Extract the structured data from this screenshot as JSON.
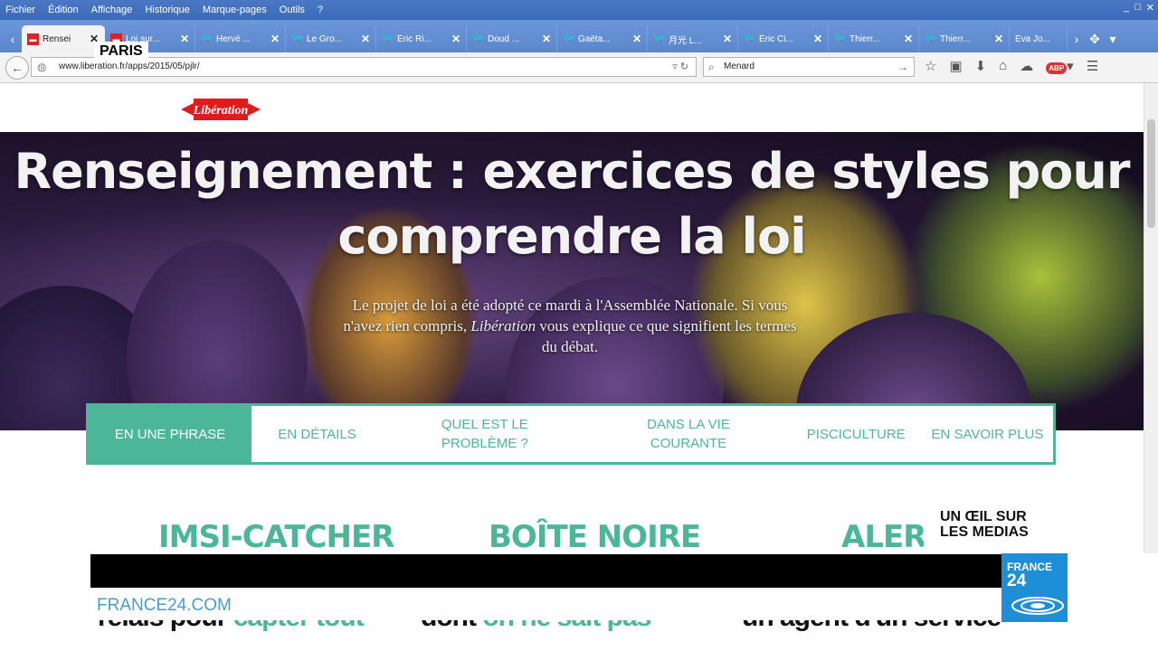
{
  "menubar": {
    "items": [
      "Fichier",
      "Édition",
      "Affichage",
      "Historique",
      "Marque-pages",
      "Outils",
      "?"
    ],
    "window_controls": [
      "_",
      "□",
      "✕"
    ]
  },
  "tabs": [
    {
      "title": "Rensei",
      "active": true,
      "icon": "liberation-favicon"
    },
    {
      "title": "Loi sur...",
      "icon": "liberation-favicon"
    },
    {
      "title": "Hervé ...",
      "icon": "twitter-icon"
    },
    {
      "title": "Le Gro...",
      "icon": "twitter-icon"
    },
    {
      "title": "Éric Ri...",
      "icon": "twitter-icon"
    },
    {
      "title": "Doud ...",
      "icon": "twitter-icon"
    },
    {
      "title": "Gaëta...",
      "icon": "twitter-icon"
    },
    {
      "title": "月光 L...",
      "icon": "twitter-icon"
    },
    {
      "title": "Eric Ci...",
      "icon": "twitter-icon"
    },
    {
      "title": "Thierr...",
      "icon": "twitter-icon"
    },
    {
      "title": "Thierr...",
      "icon": "twitter-icon"
    },
    {
      "title": "Eva Jo...",
      "icon": "twitter-icon"
    }
  ],
  "location_badge": "PARIS",
  "navbar": {
    "url": "www.liberation.fr/apps/2015/05/pjlr/",
    "search_value": "Menard"
  },
  "logo_text": "Libération",
  "hero": {
    "title_line1": "Renseignement : exercices de styles pour",
    "title_line2": "comprendre la loi",
    "intro_1": "Le projet de loi a été adopté ce mardi à l'Assemblée Nationale. Si vous n'avez rien compris, ",
    "intro_em": "Libération",
    "intro_2": " vous explique ce que signifient les termes du débat."
  },
  "menu": {
    "items": [
      {
        "label": "EN UNE PHRASE",
        "active": true
      },
      {
        "label": "EN DÉTAILS"
      },
      {
        "label": "QUEL EST LE PROBLÈME ?"
      },
      {
        "label": "DANS LA VIE COURANTE"
      },
      {
        "label": "PISCICULTURE"
      },
      {
        "label": "EN SAVOIR PLUS"
      }
    ]
  },
  "terms": [
    "IMSI-CATCHER",
    "BOÎTE NOIRE",
    "ALERTE"
  ],
  "overlay": {
    "line1": "UN ŒIL SUR",
    "line2": "LES MEDIAS"
  },
  "ticker_url": "FRANCE24.COM",
  "france24": {
    "name": "FRANCE",
    "number": "24"
  },
  "cut_text": [
    {
      "plain": "relais pour ",
      "accent": "capter tout"
    },
    {
      "plain": "dont ",
      "accent": "on ne sait pas"
    },
    {
      "plain": "un agent d'un service",
      "accent": ""
    }
  ],
  "colors": {
    "accent": "#4bb698",
    "france24_blue": "#1e8fd6",
    "tabbar": "#5a86cc"
  }
}
